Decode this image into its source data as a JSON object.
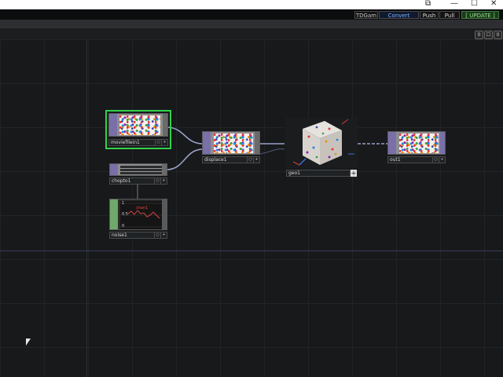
{
  "window": {
    "minimize": "—",
    "maximize": "☐",
    "close": "✕"
  },
  "toolbar": {
    "buttons": [
      {
        "label": "TDGam",
        "color": "#c8c8c8"
      },
      {
        "label": "Convert",
        "color": "#7fb3ff"
      },
      {
        "label": "Push",
        "color": "#d8d8d8"
      },
      {
        "label": "Pull",
        "color": "#d8d8d8"
      },
      {
        "label": "[ UPDATE ]",
        "color": "#8de08a"
      }
    ]
  },
  "pane": {
    "icons": [
      "0",
      "☐",
      "0"
    ]
  },
  "nodes": {
    "moviefile": {
      "label": "moviefilein1"
    },
    "displace": {
      "label": "displace1"
    },
    "geo": {
      "label": "geo1",
      "add": "+"
    },
    "out": {
      "label": "out1"
    },
    "chopto": {
      "label": "chopto1"
    },
    "noise": {
      "label": "noise1",
      "y_max": "1",
      "y_mid": "0.5",
      "y_min": "0",
      "channel": "chan1"
    }
  },
  "colors": {
    "selected_border": "#32d24a",
    "top_wire": "#9aa0c8",
    "network_bg": "#17191b"
  }
}
